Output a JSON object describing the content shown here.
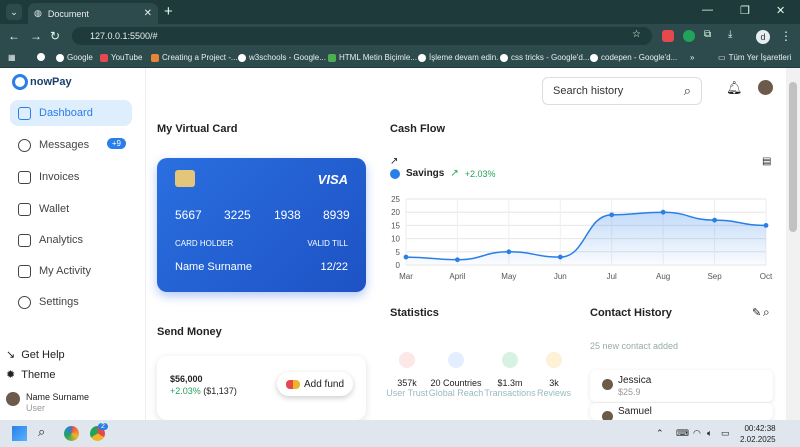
{
  "browser": {
    "tab_title": "Document",
    "url": "127.0.0.1:5500/#",
    "bookmarks": [
      "Google",
      "YouTube",
      "Creating a Project -...",
      "w3schools - Google...",
      "HTML Metin Biçimle...",
      "İşleme devam edin.",
      "css tricks - Google'd...",
      "codepen - Google'd..."
    ],
    "bookmarks_more": "»",
    "all_bookmarks": "Tüm Yer İşaretleri",
    "profile": "d"
  },
  "app": {
    "logo_text": "nowPay"
  },
  "sidebar": {
    "items": [
      {
        "label": "Dashboard"
      },
      {
        "label": "Messages",
        "badge": "+9"
      },
      {
        "label": "Invoices"
      },
      {
        "label": "Wallet"
      },
      {
        "label": "Analytics"
      },
      {
        "label": "My Activity"
      },
      {
        "label": "Settings"
      }
    ],
    "help": "Get Help",
    "theme": "Theme",
    "user_name": "Name Surname",
    "user_role": "User"
  },
  "header": {
    "search_placeholder": "Search history"
  },
  "card": {
    "section_title": "My Virtual Card",
    "brand": "VISA",
    "number": [
      "5667",
      "3225",
      "1938",
      "8939"
    ],
    "holder_label": "CARD HOLDER",
    "valid_label": "VALID TILL",
    "holder": "Name Surname",
    "valid": "12/22"
  },
  "send": {
    "title": "Send Money",
    "amount": "$56,000",
    "change": "+2.03%",
    "delta": "($1,137)",
    "add_fund": "Add fund"
  },
  "cashflow": {
    "title": "Cash Flow",
    "legend": "Savings",
    "change": "+2.03%"
  },
  "chart_data": {
    "type": "area",
    "x": [
      "Mar",
      "April",
      "May",
      "Jun",
      "Jul",
      "Aug",
      "Sep",
      "Oct"
    ],
    "series": [
      {
        "name": "Savings",
        "values": [
          3,
          2,
          5,
          3,
          19,
          20,
          17,
          15
        ]
      }
    ],
    "ylim": [
      0,
      25
    ],
    "yticks": [
      0,
      5,
      10,
      15,
      20,
      25
    ],
    "title": "Cash Flow",
    "grid": true
  },
  "statistics": {
    "title": "Statistics",
    "items": [
      {
        "value": "357k",
        "label": "User Trust",
        "color": "#e5484d"
      },
      {
        "value": "20 Countries",
        "label": "Global Reach",
        "color": "#2a7ee8"
      },
      {
        "value": "$1.3m",
        "label": "Transactions",
        "color": "#22a35a"
      },
      {
        "value": "3k",
        "label": "Reviews",
        "color": "#f0b429"
      }
    ]
  },
  "contacts": {
    "title": "Contact History",
    "subtitle": "25 new contact added",
    "list": [
      {
        "name": "Jessica",
        "amount": "$25.9"
      },
      {
        "name": "Samuel",
        "amount": ""
      }
    ]
  },
  "taskbar": {
    "time": "00:42:38",
    "date": "2.02.2025",
    "chrome_badge": "2"
  },
  "colors": {
    "accent": "#2a7ee8",
    "positive": "#22a35a"
  }
}
